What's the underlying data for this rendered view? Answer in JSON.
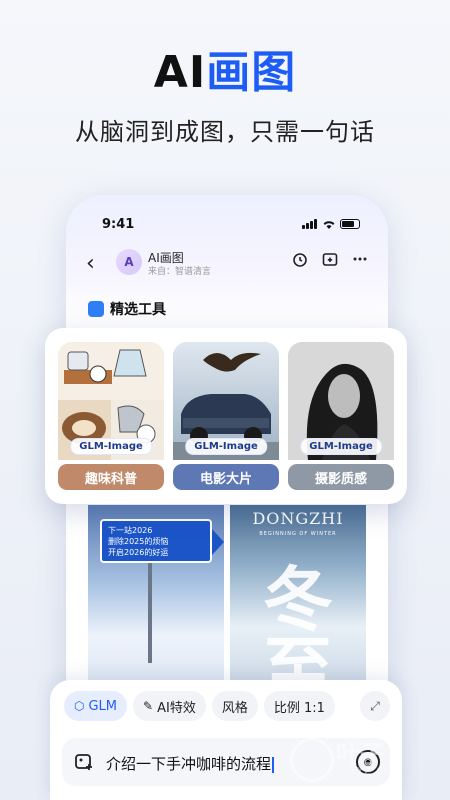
{
  "hero": {
    "title_part1": "AI",
    "title_part2": "画图",
    "subtitle": "从脑洞到成图，只需一句话"
  },
  "status_bar": {
    "time": "9:41"
  },
  "chat_header": {
    "back_icon": "chevron-left-icon",
    "bot_name": "AI画图",
    "bot_source": "来自：智谱清言",
    "actions": [
      "alarm-clock-icon",
      "folder-add-icon",
      "more-icon"
    ]
  },
  "section": {
    "title": "精选工具"
  },
  "tools": [
    {
      "tag": "GLM-Image",
      "label": "趣味科普",
      "color": "#c0896a"
    },
    {
      "tag": "GLM-Image",
      "label": "电影大片",
      "color": "#5d78b5"
    },
    {
      "tag": "GLM-Image",
      "label": "摄影质感",
      "color": "#8f99a6"
    }
  ],
  "gallery": {
    "left_sign_lines": [
      "下一站2026",
      "删除2025的烦恼",
      "开启2026的好运"
    ],
    "right_title": "DONGZHI",
    "right_subtitle": "BEGINNING OF WINTER",
    "right_big_char": "冬至"
  },
  "input": {
    "chips": [
      {
        "label": "GLM",
        "icon": "cube-icon",
        "active": true
      },
      {
        "label": "AI特效",
        "icon": "magic-wand-icon",
        "active": false
      },
      {
        "label": "风格",
        "active": false
      },
      {
        "label": "比例 1:1",
        "active": false
      }
    ],
    "text": "介绍一下手冲咖啡的流程"
  },
  "watermark": {
    "text": "叶子",
    "url": "YYZ.COM"
  },
  "colors": {
    "accent": "#1e5df5"
  }
}
